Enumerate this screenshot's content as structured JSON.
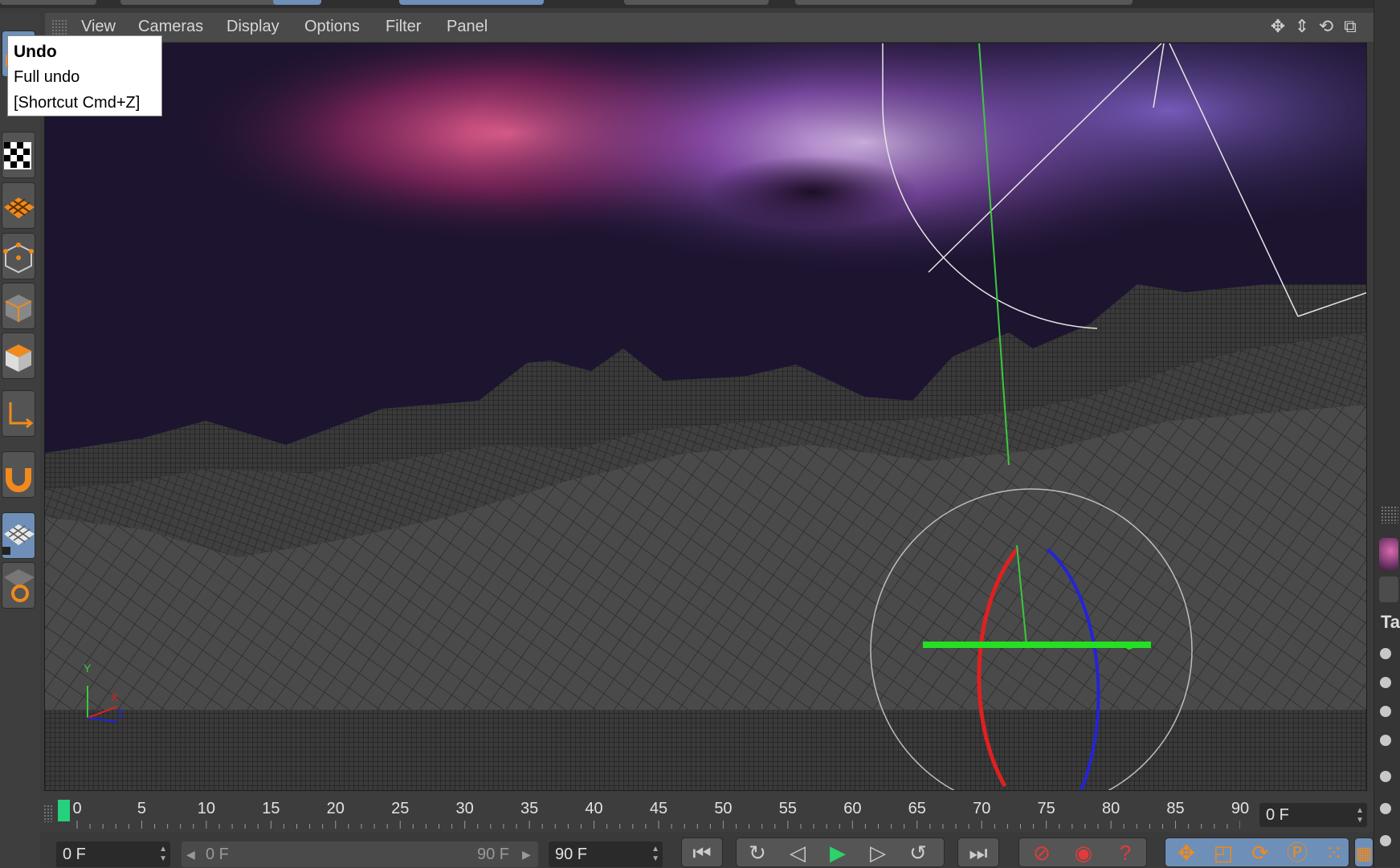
{
  "menu": {
    "items": [
      "View",
      "Cameras",
      "Display",
      "Options",
      "Filter",
      "Panel"
    ],
    "nav_icons": [
      "move-view-icon",
      "dolly-view-icon",
      "rotate-view-icon",
      "maximize-view-icon"
    ]
  },
  "tooltip": {
    "title": "Undo",
    "description": "Full undo",
    "shortcut": "[Shortcut Cmd+Z]"
  },
  "left_toolbar": {
    "icons": [
      "undo-icon",
      "checker-texture-icon",
      "polygon-mesh-icon",
      "points-mode-icon",
      "edges-mode-icon",
      "polygons-mode-icon",
      "axis-mode-icon",
      "snap-magnet-icon",
      "workplane-icon",
      "lock-workplane-icon"
    ]
  },
  "viewport": {
    "axis_labels": {
      "y": "Y",
      "x": "X",
      "z": "Z"
    }
  },
  "timeline": {
    "ticks": [
      "0",
      "5",
      "10",
      "15",
      "20",
      "25",
      "30",
      "35",
      "40",
      "45",
      "50",
      "55",
      "60",
      "65",
      "70",
      "75",
      "80",
      "85",
      "90"
    ],
    "current_frame": "0 F"
  },
  "bottom_controls": {
    "min_frame": "0 F",
    "range_start": "0 F",
    "range_end": "90 F",
    "max_frame": "90 F",
    "left_arrow": "◀",
    "right_arrow": "▶",
    "transport_icons": [
      "go-to-start-icon",
      "previous-key-icon",
      "previous-frame-icon",
      "play-icon",
      "next-frame-icon",
      "next-key-icon",
      "go-to-end-icon"
    ],
    "record_icons": [
      "record-keys-icon",
      "autokey-icon",
      "keyframe-selection-icon"
    ],
    "key_icons": [
      "position-key-icon",
      "scale-key-icon",
      "rotation-key-icon",
      "parameter-key-icon",
      "point-level-icon",
      "timeline-icon"
    ]
  },
  "right_panel": {
    "label": "Ta"
  }
}
